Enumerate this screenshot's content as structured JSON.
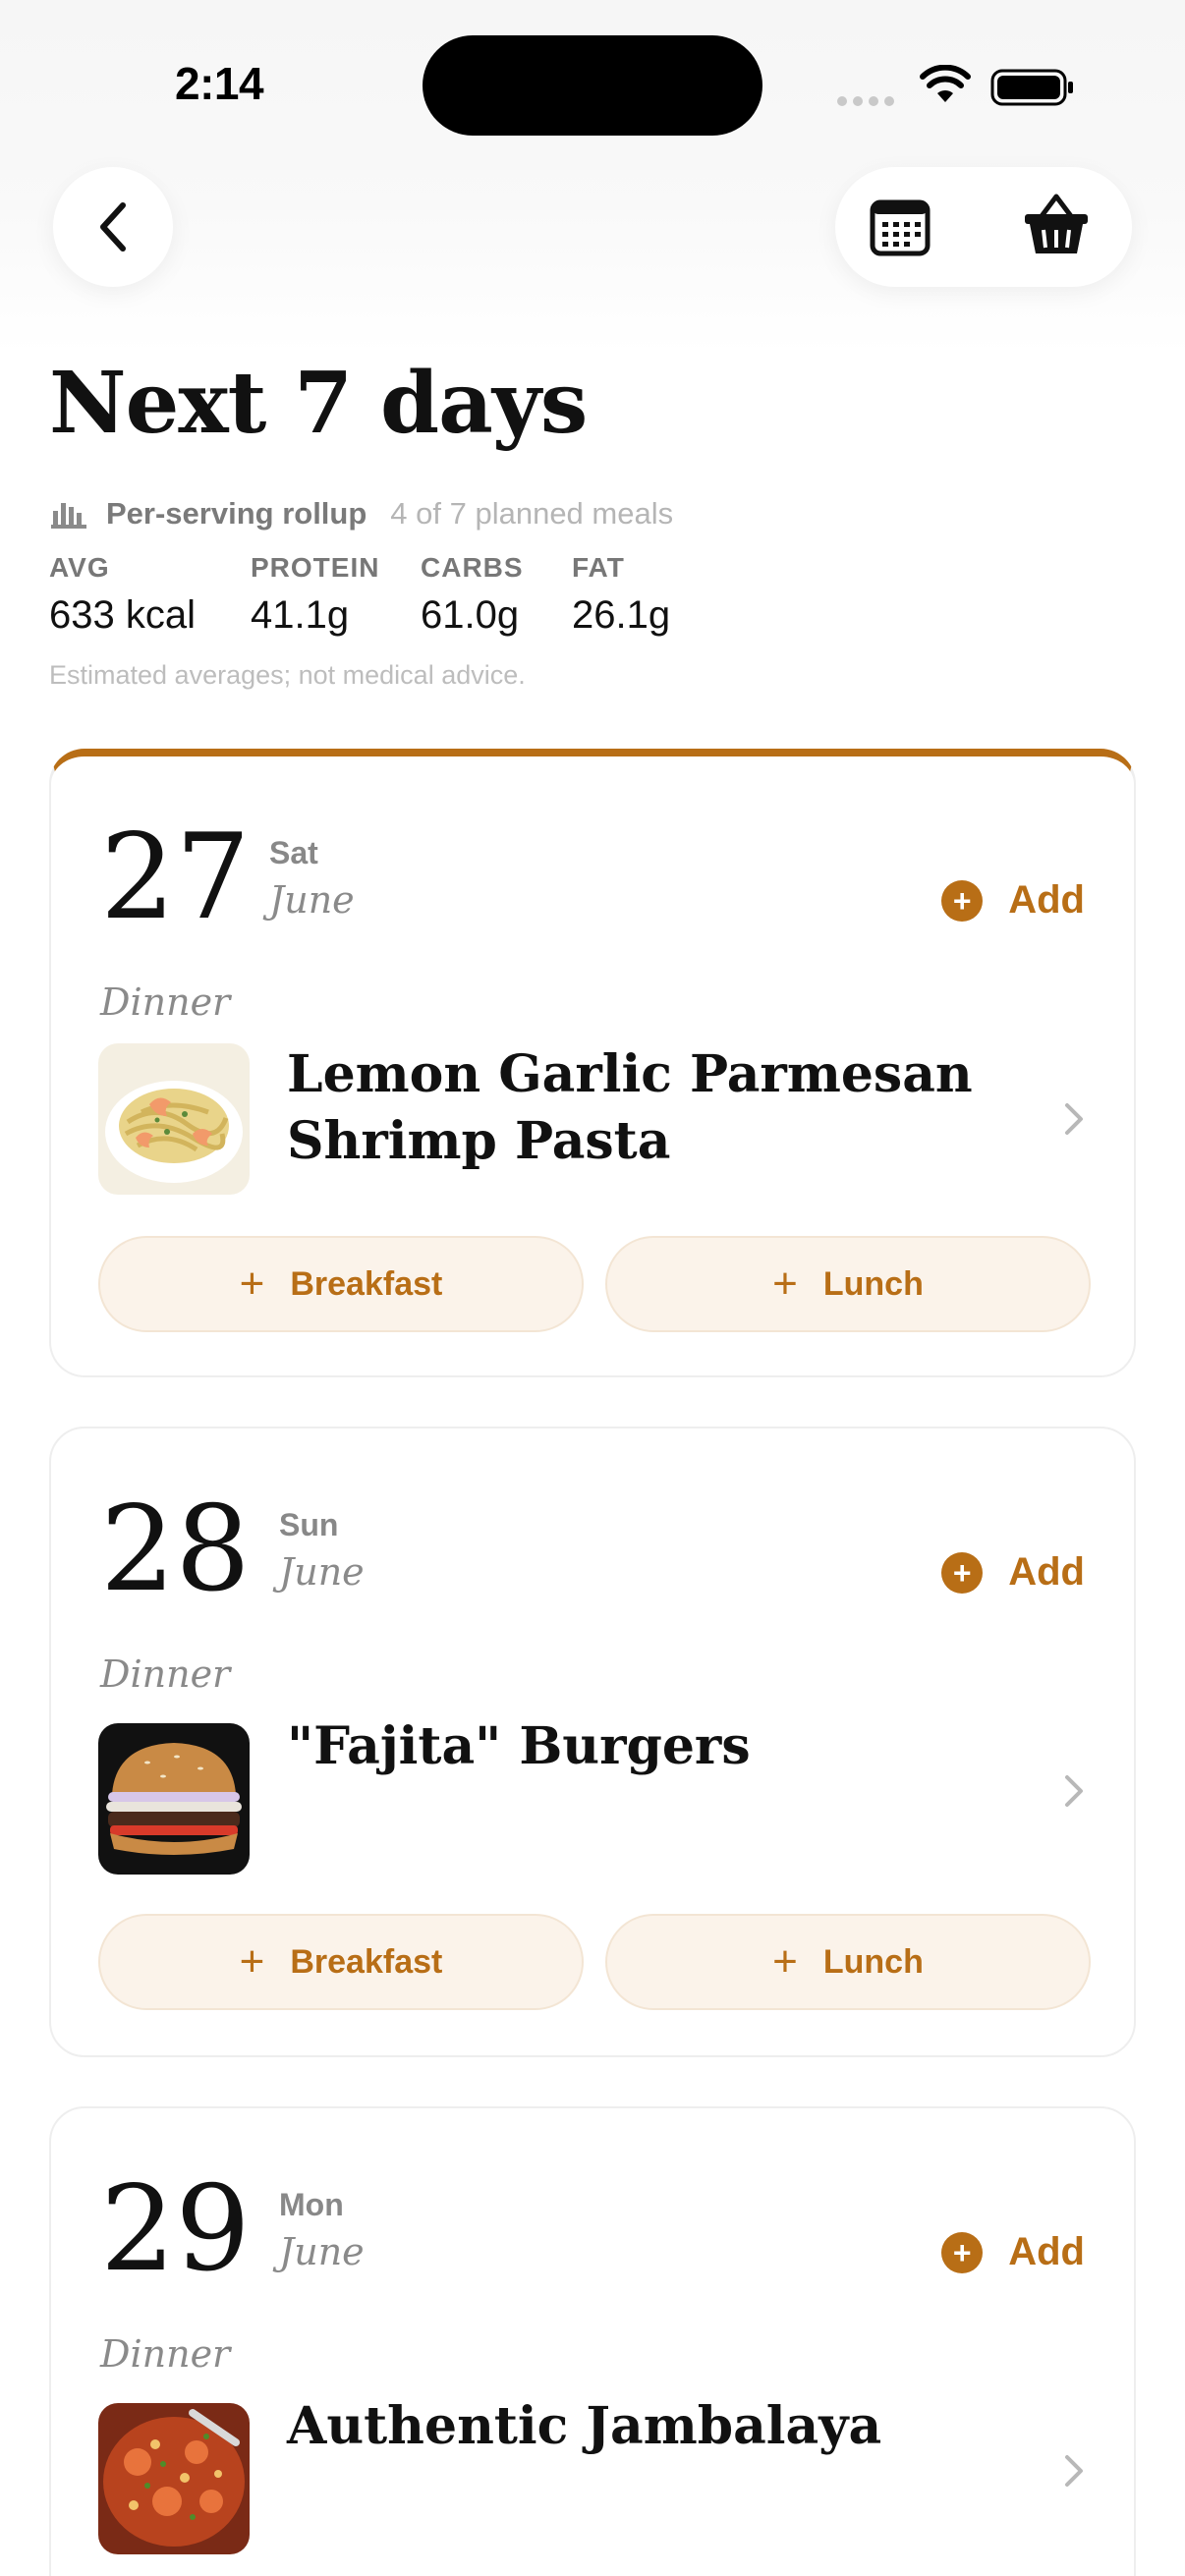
{
  "status_bar": {
    "time": "2:14"
  },
  "nav": {
    "back_icon": "chevron-left-icon",
    "calendar_icon": "calendar-icon",
    "basket_icon": "shopping-basket-icon"
  },
  "header": {
    "title": "Next 7 days",
    "rollup_label": "Per-serving rollup",
    "rollup_count": "4 of 7 planned meals",
    "disclaimer": "Estimated averages; not medical advice."
  },
  "macros": [
    {
      "label": "AVG",
      "value": "633 kcal"
    },
    {
      "label": "PROTEIN",
      "value": "41.1g"
    },
    {
      "label": "CARBS",
      "value": "61.0g"
    },
    {
      "label": "FAT",
      "value": "26.1g"
    }
  ],
  "days": [
    {
      "day": "27",
      "weekday": "Sat",
      "month": "June",
      "add_label": "Add",
      "meal_type": "Dinner",
      "meal_title": "Lemon Garlic Parmesan Shrimp Pasta",
      "slots": [
        "Breakfast",
        "Lunch"
      ]
    },
    {
      "day": "28",
      "weekday": "Sun",
      "month": "June",
      "add_label": "Add",
      "meal_type": "Dinner",
      "meal_title": "\"Fajita\" Burgers",
      "slots": [
        "Breakfast",
        "Lunch"
      ]
    },
    {
      "day": "29",
      "weekday": "Mon",
      "month": "June",
      "add_label": "Add",
      "meal_type": "Dinner",
      "meal_title": "Authentic Jambalaya"
    }
  ],
  "colors": {
    "accent": "#b86e16",
    "slot_bg": "#fbf3ea"
  }
}
